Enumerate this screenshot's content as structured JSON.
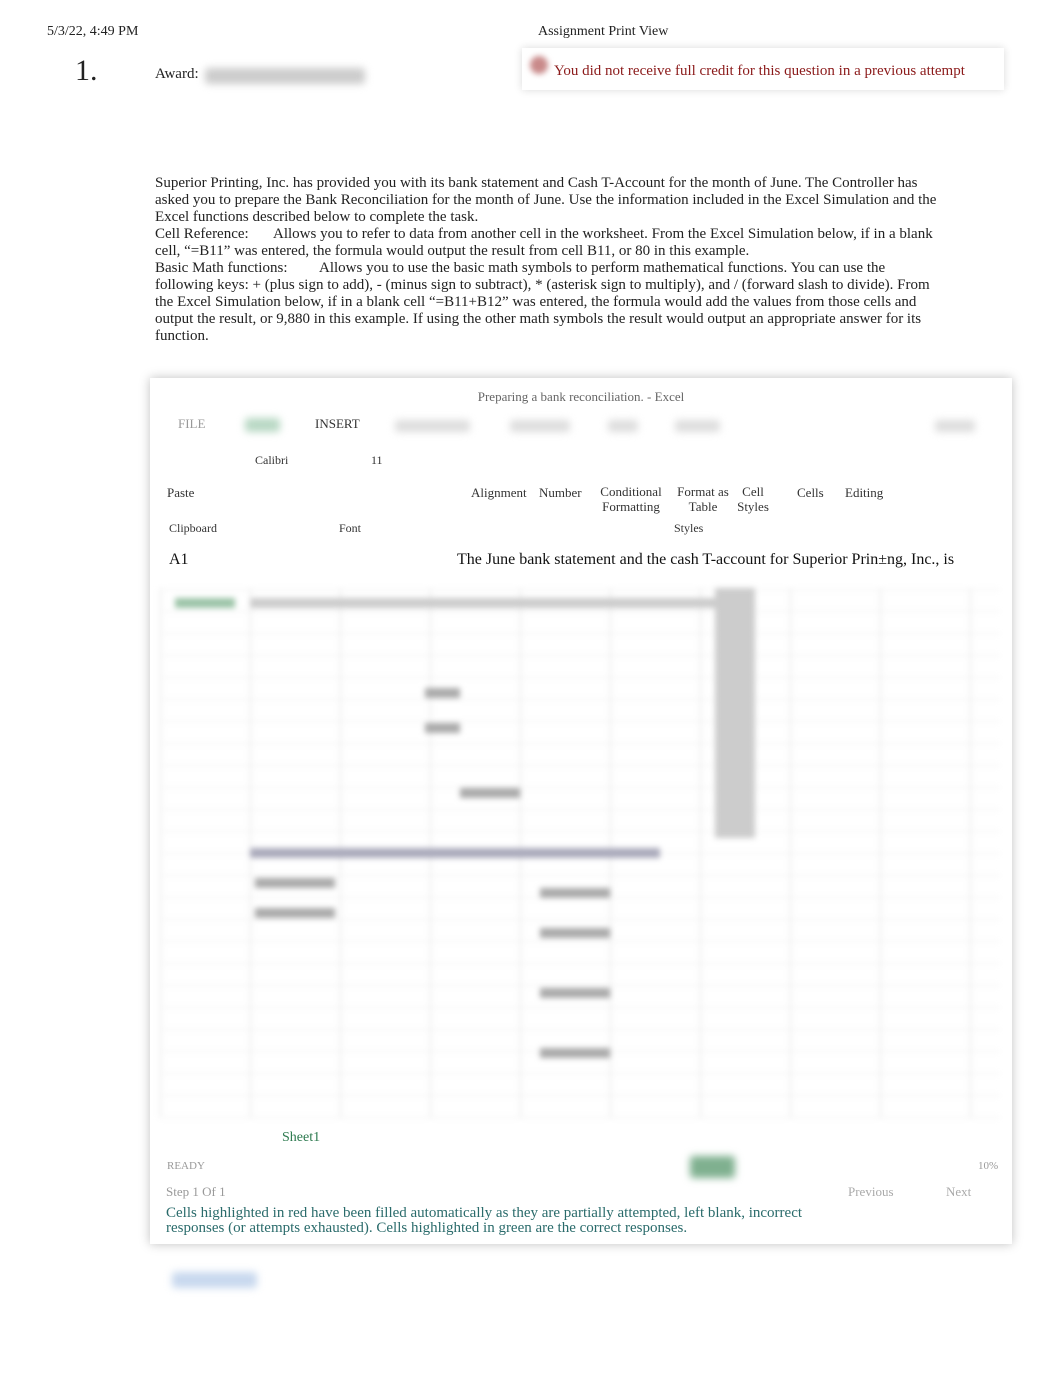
{
  "header": {
    "timestamp": "5/3/22, 4:49 PM",
    "title": "Assignment Print View"
  },
  "question": {
    "number": "1.",
    "award_label": "Award:",
    "alert": "You did not receive full credit for this question in a previous attempt"
  },
  "intro": "Superior Printing, Inc. has provided you with its bank statement and Cash T-Account for the month of June. The Controller has asked you to prepare the Bank Reconciliation for the month of June. Use the information included in the Excel Simulation and the Excel functions described below to complete the task.",
  "functions": [
    {
      "name": "Cell Reference:",
      "desc": "Allows you to refer to data from another cell in the worksheet. From the Excel Simulation below, if in a blank cell, “=B11” was entered, the formula would output the result from cell B11, or 80 in this example."
    },
    {
      "name": "Basic Math functions:",
      "desc": "Allows you to use the basic math symbols to perform mathematical functions. You can use the following keys: + (plus sign to add), - (minus sign to subtract), * (asterisk sign to multiply), and / (forward slash to divide). From the Excel Simulation below, if in a blank cell “=B11+B12” was entered, the formula would add the values from those cells and output the result, or 9,880 in this example. If using the other math symbols the result would output an appropriate answer for its function."
    }
  ],
  "excel": {
    "window_title": "Preparing a bank reconciliation. - Excel",
    "tabs": [
      "FILE",
      "INSERT"
    ],
    "font_name": "Calibri",
    "font_size": "11",
    "ribbon": {
      "paste": "Paste",
      "alignment": "Alignment",
      "number": "Number",
      "conditional": "Conditional Formatting",
      "format_table": "Format as Table",
      "cell_styles": "Cell Styles",
      "cells": "Cells",
      "editing": "Editing"
    },
    "groups": {
      "clipboard": "Clipboard",
      "font": "Font",
      "styles": "Styles"
    },
    "name_box": "A1",
    "formula": "The June bank statement and the cash T-account for Superior Prin±ng, Inc., is",
    "sheet_tab": "Sheet1",
    "status": "READY",
    "zoom": "10%",
    "step": "Step 1 Of 1",
    "previous": "Previous",
    "next": "Next",
    "note": "Cells highlighted in red have been filled automatically as they are partially attempted, left blank, incorrect responses (or attempts exhausted). Cells highlighted in green are the correct responses."
  }
}
